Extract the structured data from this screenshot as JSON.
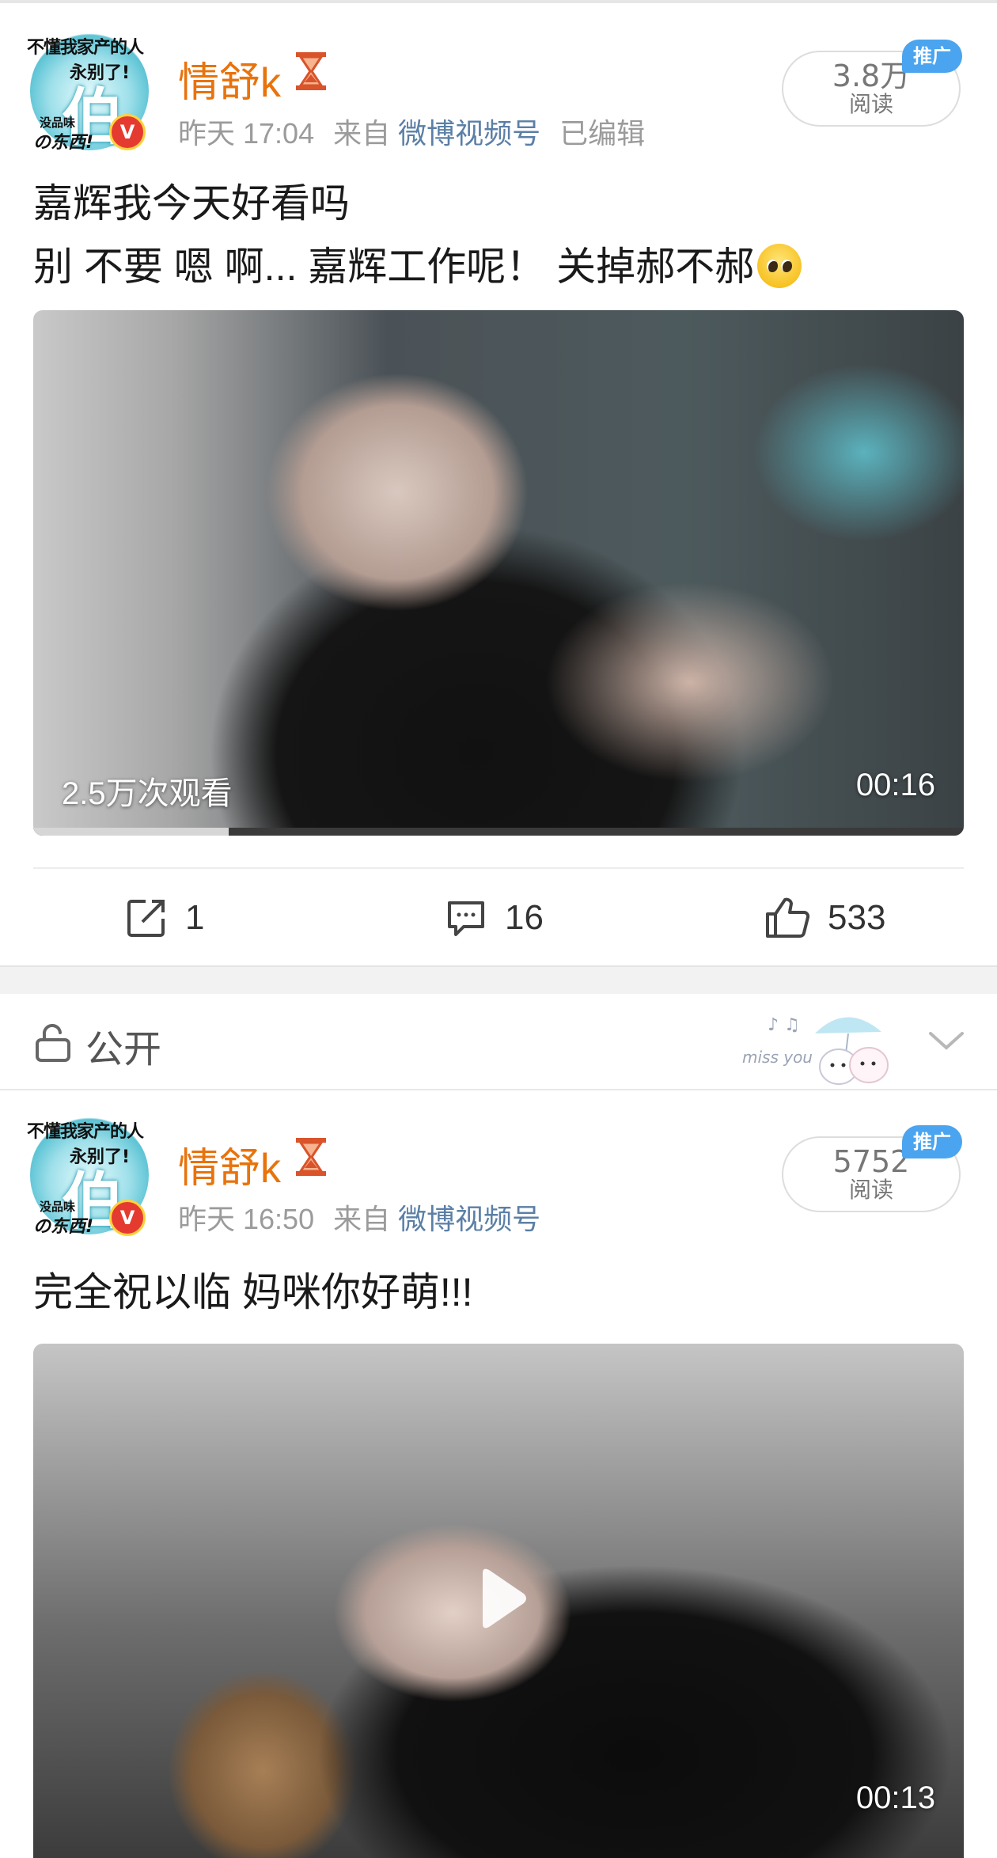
{
  "posts": [
    {
      "avatar": {
        "top": "不懂我家产的人",
        "mid": "永别了!",
        "big": "伯",
        "small": "没品味",
        "bottom": "の东西!",
        "badge": "V"
      },
      "username": "情舒k",
      "time": "昨天 17:04",
      "source_prefix": "来自",
      "source": "微博视频号",
      "edited": "已编辑",
      "reads": "3.8万",
      "reads_label": "阅读",
      "promo": "推广",
      "text_line1": "嘉辉我今天好看吗",
      "text_line2": "别 不要 嗯 啊... 嘉辉工作呢！ 关掉郝不郝",
      "emoji": "pleading-face-emoji",
      "video": {
        "views": "2.5万次观看",
        "duration": "00:16",
        "progress": 0.21
      },
      "actions": {
        "share": "1",
        "comment": "16",
        "like": "533"
      }
    },
    {
      "avatar": {
        "top": "不懂我家产的人",
        "mid": "永别了!",
        "big": "伯",
        "small": "没品味",
        "bottom": "の东西!",
        "badge": "V"
      },
      "username": "情舒k",
      "time": "昨天 16:50",
      "source_prefix": "来自",
      "source": "微博视频号",
      "reads": "5752",
      "reads_label": "阅读",
      "promo": "推广",
      "text_line1": "完全祝以临 妈咪你好萌!!!",
      "video": {
        "duration": "00:13"
      }
    }
  ],
  "visibility": {
    "label": "公开",
    "deco_text": "miss you"
  },
  "colors": {
    "username": "#e8730c",
    "source": "#5b7fa6",
    "promo": "#4aa4ef",
    "meta": "#9b9b9b"
  }
}
